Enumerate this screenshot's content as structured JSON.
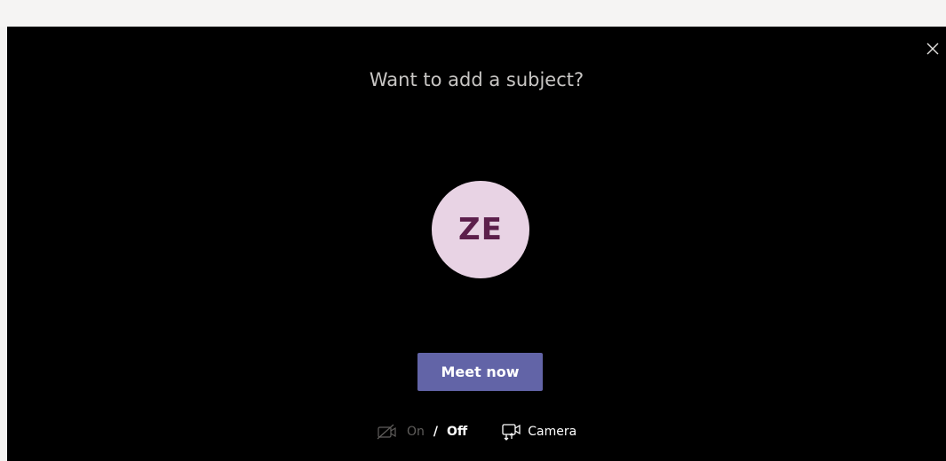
{
  "dialog": {
    "subject_placeholder": "Want to add a subject?",
    "avatar_initials": "ZE",
    "meet_button_label": "Meet now",
    "video_toggle": {
      "on_label": "On",
      "separator": "/",
      "off_label": "Off",
      "state": "off"
    },
    "camera_label": "Camera"
  },
  "icons": {
    "close": "close-icon",
    "video_off": "video-off-icon",
    "camera_settings": "camera-settings-icon"
  },
  "colors": {
    "panel_background": "#000000",
    "accent": "#6264a7",
    "avatar_background": "#e8d3e4",
    "avatar_text": "#5c1f4b",
    "muted_text": "#605e5c"
  }
}
